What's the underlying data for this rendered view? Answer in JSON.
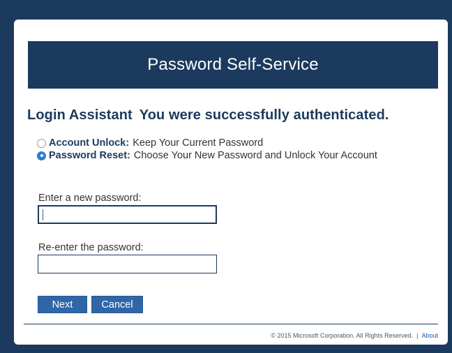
{
  "banner": {
    "title": "Password Self-Service"
  },
  "heading": {
    "title": "Login Assistant",
    "status": "You were successfully authenticated."
  },
  "options": [
    {
      "name": "Account Unlock:",
      "desc": "Keep Your Current Password",
      "checked": false
    },
    {
      "name": "Password Reset:",
      "desc": "Choose Your New Password and Unlock Your Account",
      "checked": true
    }
  ],
  "form": {
    "new_password_label": "Enter a new password:",
    "new_password_value": "",
    "reenter_label": "Re-enter the password:",
    "reenter_value": ""
  },
  "buttons": {
    "next": "Next",
    "cancel": "Cancel"
  },
  "footer": {
    "copyright": "© 2015 Microsoft Corporation. All Rights Reserved.",
    "separator": "|",
    "about": "About"
  },
  "colors": {
    "brand": "#1c3a5e",
    "button": "#2f66a8",
    "radio_selected": "#2a7fd4"
  },
  "icons": {
    "option_unselected": "radio-unchecked-icon",
    "option_selected": "radio-checked-icon"
  }
}
